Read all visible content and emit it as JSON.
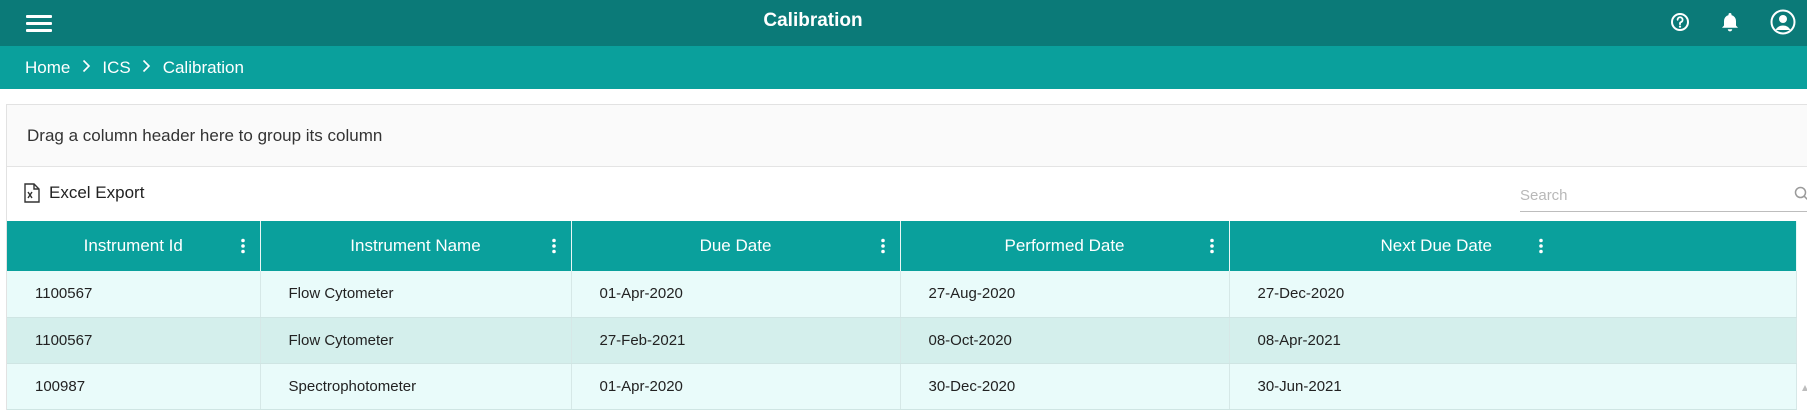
{
  "header": {
    "title": "Calibration",
    "menu_icon": "hamburger-menu-icon",
    "help_icon": "help-icon",
    "bell_icon": "notification-bell-icon",
    "user_icon": "user-account-icon"
  },
  "breadcrumb": {
    "items": [
      "Home",
      "ICS",
      "Calibration"
    ],
    "separator_icon": "chevron-right-icon"
  },
  "grid": {
    "group_hint": "Drag a column header here to group its column",
    "export_label": "Excel Export",
    "search_placeholder": "Search",
    "columns": [
      "Instrument Id",
      "Instrument Name",
      "Due Date",
      "Performed Date",
      "Next Due Date"
    ],
    "rows": [
      [
        "1100567",
        "Flow Cytometer",
        "01-Apr-2020",
        "27-Aug-2020",
        "27-Dec-2020"
      ],
      [
        "1100567",
        "Flow Cytometer",
        "27-Feb-2021",
        "08-Oct-2020",
        "08-Apr-2021"
      ],
      [
        "100987",
        "Spectrophotometer",
        "01-Apr-2020",
        "30-Dec-2020",
        "30-Jun-2021"
      ]
    ]
  },
  "colors": {
    "topbar": "#0b7a78",
    "accent": "#0aa09c",
    "row_odd": "#e9fbfa",
    "row_even": "#d4efec"
  }
}
